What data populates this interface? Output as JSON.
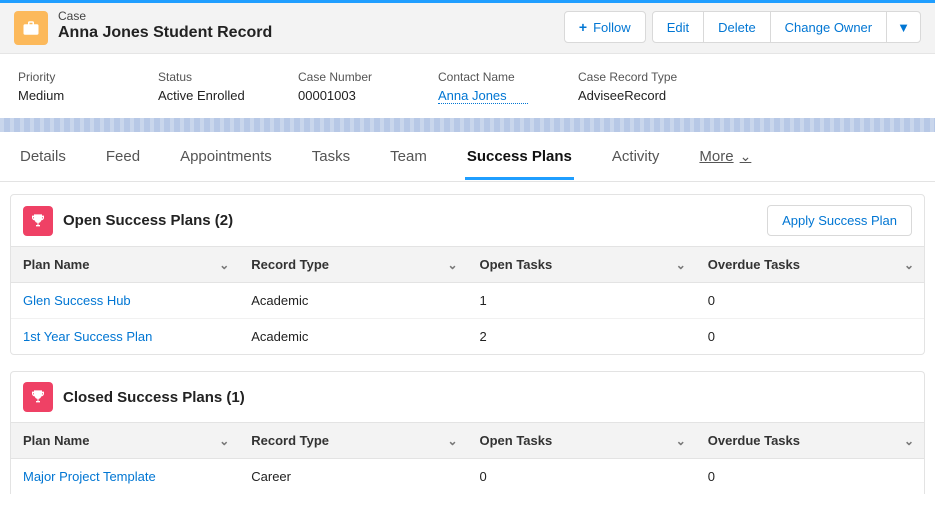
{
  "header": {
    "object_label": "Case",
    "title": "Anna Jones Student Record",
    "actions": {
      "follow": "Follow",
      "edit": "Edit",
      "delete": "Delete",
      "change_owner": "Change Owner"
    }
  },
  "fields": {
    "priority": {
      "label": "Priority",
      "value": "Medium"
    },
    "status": {
      "label": "Status",
      "value": "Active Enrolled"
    },
    "case_number": {
      "label": "Case Number",
      "value": "00001003"
    },
    "contact_name": {
      "label": "Contact Name",
      "value": "Anna Jones"
    },
    "record_type": {
      "label": "Case Record Type",
      "value": "AdviseeRecord"
    }
  },
  "tabs": {
    "details": "Details",
    "feed": "Feed",
    "appointments": "Appointments",
    "tasks": "Tasks",
    "team": "Team",
    "success_plans": "Success Plans",
    "activity": "Activity",
    "more": "More"
  },
  "open_plans": {
    "title": "Open Success Plans (2)",
    "apply_label": "Apply Success Plan",
    "columns": {
      "plan_name": "Plan Name",
      "record_type": "Record Type",
      "open_tasks": "Open Tasks",
      "overdue_tasks": "Overdue Tasks"
    },
    "rows": [
      {
        "plan_name": "Glen Success Hub",
        "record_type": "Academic",
        "open_tasks": "1",
        "overdue_tasks": "0"
      },
      {
        "plan_name": "1st Year Success Plan",
        "record_type": "Academic",
        "open_tasks": "2",
        "overdue_tasks": "0"
      }
    ]
  },
  "closed_plans": {
    "title": "Closed Success Plans (1)",
    "columns": {
      "plan_name": "Plan Name",
      "record_type": "Record Type",
      "open_tasks": "Open Tasks",
      "overdue_tasks": "Overdue Tasks"
    },
    "rows": [
      {
        "plan_name": "Major Project Template",
        "record_type": "Career",
        "open_tasks": "0",
        "overdue_tasks": "0"
      }
    ]
  }
}
